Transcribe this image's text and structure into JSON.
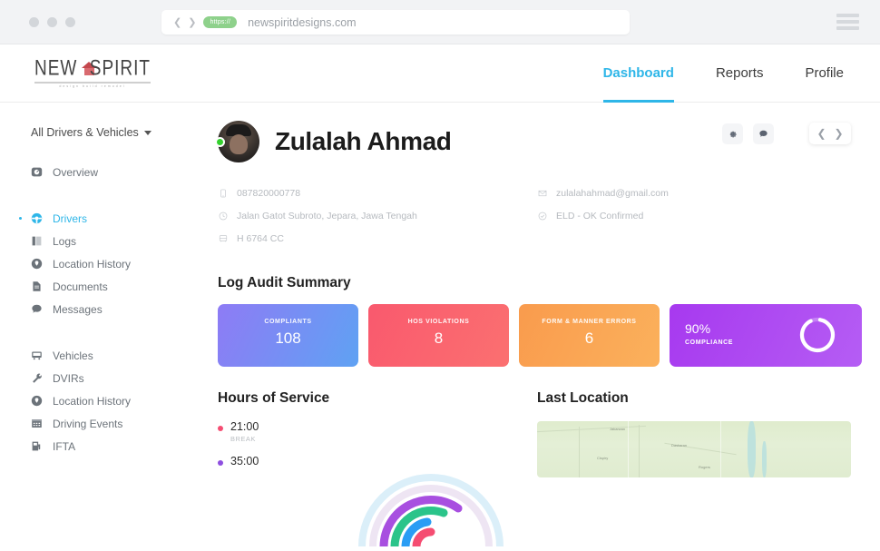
{
  "browser": {
    "back_icon": "chevron-left-icon",
    "forward_icon": "chevron-right-icon",
    "https_label": "https://",
    "url": "newspiritdesigns.com",
    "menu_icon": "hamburger-menu-icon"
  },
  "header": {
    "logo": {
      "word_left": "NEW",
      "word_right": "SPIRIT",
      "tagline": "design     build     remodel",
      "house_icon": "house-icon"
    },
    "nav": [
      {
        "label": "Dashboard",
        "active": true
      },
      {
        "label": "Reports",
        "active": false
      },
      {
        "label": "Profile",
        "active": false
      }
    ],
    "accent_color": "#2eb6e8"
  },
  "sidebar": {
    "selector_label": "All Drivers & Vehicles",
    "selector_icon": "chevron-down-icon",
    "group_one": [
      {
        "label": "Overview",
        "icon": "gauge-icon",
        "active": false
      }
    ],
    "group_two": [
      {
        "label": "Drivers",
        "icon": "steering-wheel-icon",
        "active": true
      },
      {
        "label": "Logs",
        "icon": "book-icon",
        "active": false
      },
      {
        "label": "Location History",
        "icon": "map-pin-icon",
        "active": false
      },
      {
        "label": "Documents",
        "icon": "document-icon",
        "active": false
      },
      {
        "label": "Messages",
        "icon": "chat-bubble-icon",
        "active": false
      }
    ],
    "group_three": [
      {
        "label": "Vehicles",
        "icon": "truck-icon",
        "active": false
      },
      {
        "label": "DVIRs",
        "icon": "wrench-icon",
        "active": false
      },
      {
        "label": "Location History",
        "icon": "map-pin-icon",
        "active": false
      },
      {
        "label": "Driving Events",
        "icon": "calendar-icon",
        "active": false
      },
      {
        "label": "IFTA",
        "icon": "fuel-pump-icon",
        "active": false
      }
    ]
  },
  "profile": {
    "name": "Zulalah Ahmad",
    "avatar_icon": "user-avatar",
    "status": "online",
    "status_color": "#34d12e",
    "actions": [
      {
        "icon": "gear-icon",
        "name": "settings-button"
      },
      {
        "icon": "chat-bubble-icon",
        "name": "message-button"
      }
    ],
    "pager": {
      "prev_icon": "chevron-left-icon",
      "next_icon": "chevron-right-icon"
    },
    "details_left": [
      {
        "icon": "phone-icon",
        "value": "087820000778"
      },
      {
        "icon": "clock-icon",
        "value": "Jalan Gatot Subroto, Jepara, Jawa Tengah"
      },
      {
        "icon": "truck-icon",
        "value": "H 6764 CC"
      }
    ],
    "details_right": [
      {
        "icon": "envelope-icon",
        "value": "zulalahahmad@gmail.com"
      },
      {
        "icon": "check-circle-icon",
        "value": "ELD - OK Confirmed"
      }
    ]
  },
  "audit": {
    "title": "Log Audit Summary",
    "cards": [
      {
        "label": "COMPLIANTS",
        "value": "108",
        "color": "#7b83f4"
      },
      {
        "label": "HOS VIOLATIONS",
        "value": "8",
        "color": "#f9596e"
      },
      {
        "label": "FORM & MANNER ERRORS",
        "value": "6",
        "color": "#f99b4d"
      }
    ],
    "compliance": {
      "percent": "90%",
      "label": "COMPLIANCE",
      "value": 90,
      "color": "#a739ef"
    }
  },
  "hours_of_service": {
    "title": "Hours of Service",
    "legend": [
      {
        "time": "21:00",
        "label": "BREAK",
        "color": "#f54d72"
      },
      {
        "time": "35:00",
        "label": "",
        "color": "#8e4fe0"
      }
    ],
    "chart_data": {
      "type": "pie",
      "title": "Hours of Service",
      "categories": [
        "BREAK",
        "35:00"
      ],
      "values": [
        21,
        35
      ],
      "colors": [
        "#f54d72",
        "#8e4fe0"
      ],
      "arc_colors": [
        "#2a9df4",
        "#2bc48a",
        "#a84fe0",
        "#f54d72",
        "#eadff0",
        "#cfe9f7"
      ]
    }
  },
  "last_location": {
    "title": "Last Location",
    "map_labels": [
      "Jakarwan",
      "Daskaran",
      "Cispiry",
      "Rogers"
    ]
  }
}
